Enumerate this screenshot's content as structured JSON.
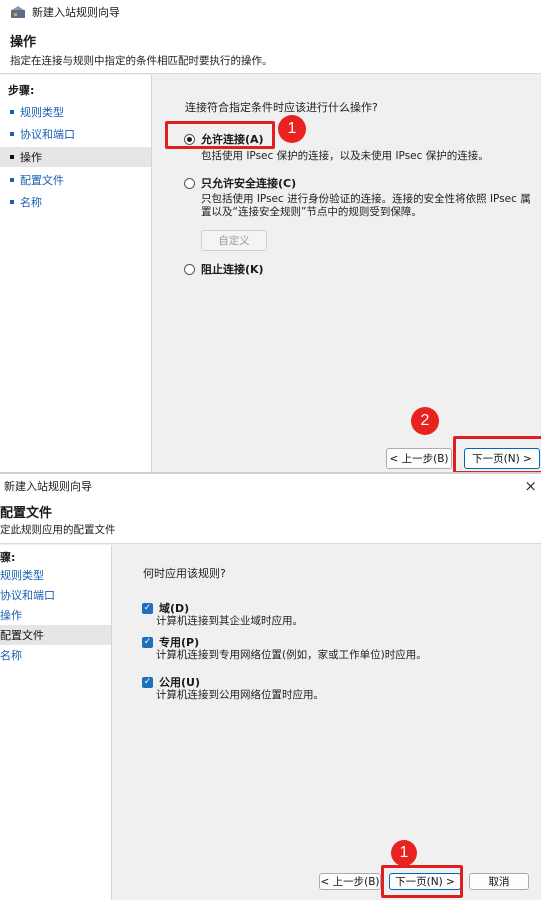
{
  "wizard1": {
    "window_title": "新建入站规则向导",
    "header_title": "操作",
    "header_subtitle": "指定在连接与规则中指定的条件相匹配时要执行的操作。",
    "steps_title": "步骤:",
    "steps": [
      "规则类型",
      "协议和端口",
      "操作",
      "配置文件",
      "名称"
    ],
    "active_step": "操作",
    "question": "连接符合指定条件时应该进行什么操作?",
    "options": [
      {
        "label": "允许连接(A)",
        "selected": true,
        "desc": "包括使用 IPsec 保护的连接，以及未使用 IPsec 保护的连接。"
      },
      {
        "label": "只允许安全连接(C)",
        "selected": false,
        "desc_line1": "只包括使用 IPsec 进行身份验证的连接。连接的安全性将依照 IPsec 属",
        "desc_line2": "置以及“连接安全规则”节点中的规则受到保障。"
      },
      {
        "label": "阻止连接(K)",
        "selected": false
      }
    ],
    "customize_button": "自定义",
    "back_button": "< 上一步(B)",
    "next_button": "下一页(N) >",
    "badge_1": "1",
    "badge_2": "2"
  },
  "wizard2": {
    "window_title": "新建入站规则向导",
    "close_icon": "×",
    "header_title": "配置文件",
    "header_subtitle": "定此规则应用的配置文件",
    "steps_title": "骤:",
    "steps": [
      "规则类型",
      "协议和端口",
      "操作",
      "配置文件",
      "名称"
    ],
    "active_step": "配置文件",
    "question": "何时应用该规则?",
    "profiles": [
      {
        "label": "域(D)",
        "checked": true,
        "desc": "计算机连接到其企业域时应用。"
      },
      {
        "label": "专用(P)",
        "checked": true,
        "desc": "计算机连接到专用网络位置(例如，家或工作单位)时应用。"
      },
      {
        "label": "公用(U)",
        "checked": true,
        "desc": "计算机连接到公用网络位置时应用。"
      }
    ],
    "back_button": "< 上一步(B)",
    "next_button": "下一页(N) >",
    "cancel_button": "取消",
    "badge_1": "1"
  },
  "colors": {
    "annotation_red": "#e02020",
    "link_blue": "#1a5fb4",
    "checkbox_blue": "#1f6fbf"
  }
}
